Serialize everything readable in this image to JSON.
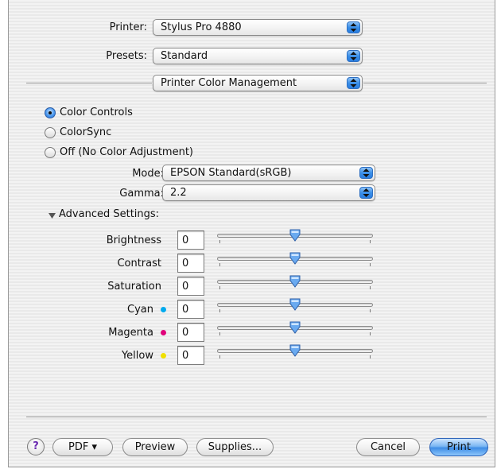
{
  "printer": {
    "label": "Printer:",
    "value": "Stylus Pro 4880"
  },
  "presets": {
    "label": "Presets:",
    "value": "Standard"
  },
  "panel": {
    "value": "Printer Color Management"
  },
  "color_mode": {
    "options": [
      {
        "label": "Color Controls",
        "selected": true
      },
      {
        "label": "ColorSync",
        "selected": false
      },
      {
        "label": "Off (No Color Adjustment)",
        "selected": false
      }
    ]
  },
  "mode": {
    "label": "Mode:",
    "value": "EPSON Standard(sRGB)"
  },
  "gamma": {
    "label": "Gamma:",
    "value": "2.2"
  },
  "advanced": {
    "label": "Advanced Settings:",
    "expanded": true,
    "rows": [
      {
        "label": "Brightness",
        "value": "0",
        "level": 0.5
      },
      {
        "label": "Contrast",
        "value": "0",
        "level": 0.5
      },
      {
        "label": "Saturation",
        "value": "0",
        "level": 0.5
      },
      {
        "label": "Cyan",
        "value": "0",
        "level": 0.5,
        "dot_color": "#00aaee"
      },
      {
        "label": "Magenta",
        "value": "0",
        "level": 0.5,
        "dot_color": "#e0007a"
      },
      {
        "label": "Yellow",
        "value": "0",
        "level": 0.5,
        "dot_color": "#f0e000"
      }
    ]
  },
  "footer": {
    "help": "?",
    "pdf": "PDF ▾",
    "preview": "Preview",
    "supplies": "Supplies...",
    "cancel": "Cancel",
    "print": "Print"
  }
}
